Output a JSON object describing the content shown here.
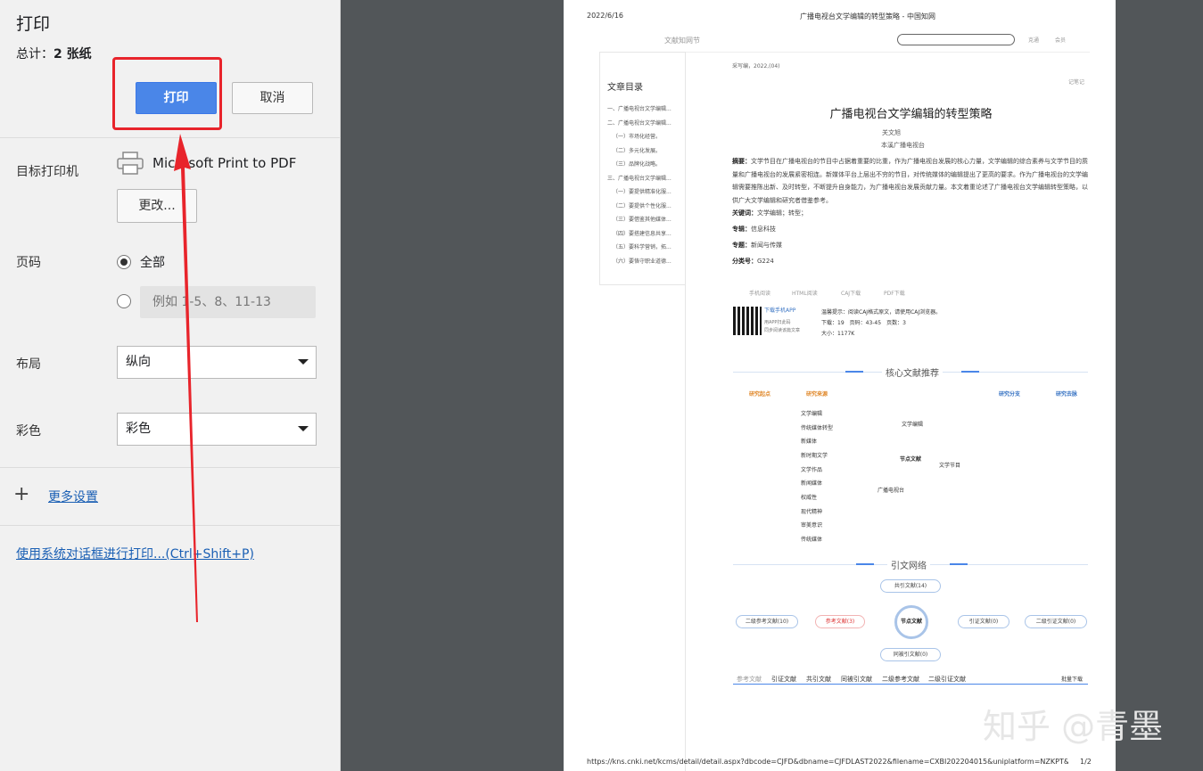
{
  "panel": {
    "title": "打印",
    "total_label": "总计：",
    "total_value": "2 张纸",
    "print_button": "打印",
    "cancel_button": "取消",
    "destination_label": "目标打印机",
    "printer_name": "Microsoft Print to PDF",
    "change_button": "更改...",
    "pages_label": "页码",
    "pages_all": "全部",
    "pages_custom_placeholder": "例如 1-5、8、11-13",
    "layout_label": "布局",
    "layout_value": "纵向",
    "color_label": "彩色",
    "color_value": "彩色",
    "more_settings": "更多设置",
    "system_dialog": "使用系统对话框进行打印...(Ctrl+Shift+P)"
  },
  "preview": {
    "date": "2022/6/16",
    "doc_title": "广播电视台文学编辑的转型策略 - 中国知网",
    "site_section": "文献知网节",
    "nav_links": [
      "克通",
      "会员"
    ],
    "journal_info": "采写编，2022,(04)",
    "note_link": "记笔记",
    "toc_title": "文章目录",
    "toc_items": [
      "一、广播电视台文学编辑...",
      "二、广播电视台文学编辑...",
      "（一）市场化经营。",
      "（二）多元化发展。",
      "（三）品牌化战略。",
      "三、广播电视台文学编辑...",
      "（一）要提供精准化服...",
      "（二）要提供个性化服...",
      "（三）要借鉴其他媒体...",
      "（四）要搭建信息共享...",
      "（五）要科学营销，拓...",
      "（六）要恪守职业道德..."
    ],
    "article_title": "广播电视台文学编辑的转型策略",
    "author": "关文旭",
    "affiliation": "本溪广播电视台",
    "abstract_label": "摘要：",
    "abstract_text": "文学节目在广播电视台的节目中占据着重要的比重，作为广播电视台发展的核心力量，文学编辑的综合素养与文学节目的质量和广播电视台的发展紧密相连。新媒体平台上层出不穷的节目，对传统媒体的编辑提出了更高的要求。作为广播电视台的文学编辑需要推陈出新、及时转型，不断提升自身能力，为广播电视台发展贡献力量。本文着重论述了广播电视台文学编辑转型策略，以供广大文学编辑和研究者借鉴参考。",
    "keywords_label": "关键词：",
    "keywords_value": "文学编辑；转型；",
    "subject_label": "专辑：",
    "subject_value": "信息科技",
    "topic_label": "专题：",
    "topic_value": "新闻与传媒",
    "class_label": "分类号：",
    "class_value": "G224",
    "download_tabs": [
      "手机阅读",
      "HTML阅读",
      "CAJ下载",
      "PDF下载"
    ],
    "app_download": "下载手机APP",
    "app_scan": "用APP扫此码",
    "app_sync": "同步阅读该篇文章",
    "reading_tip": "温馨提示：阅读CAJ格式原文，请使用CAJ浏览器。",
    "download_stats": "下载：19　页码：43-45　页数：3",
    "file_size": "大小：1177K",
    "core_recommend": "核心文献推荐",
    "network_labels": [
      "研究起点",
      "研究来源",
      "研究分支",
      "研究去脉"
    ],
    "network_words": [
      "文学编辑",
      "传统媒体转型",
      "新媒体",
      "新时期文学",
      "文学作品",
      "新闻媒体",
      "权威性",
      "现代精神",
      "审美意识",
      "传统媒体"
    ],
    "network_center": [
      "文学编辑",
      "节点文献",
      "文学节目",
      "广播电视台"
    ],
    "citation_network": "引文网络",
    "citation_nodes": [
      "共引文献(14)",
      "二级参考文献(10)",
      "参考文献(3)",
      "节点文献",
      "引证文献(0)",
      "二级引证文献(0)",
      "同被引文献(0)"
    ],
    "bottom_tabs": [
      "参考文献",
      "引证文献",
      "共引文献",
      "同被引文献",
      "二级参考文献",
      "二级引证文献"
    ],
    "batch_download": "批量下载",
    "url": "https://kns.cnki.net/kcms/detail/detail.aspx?dbcode=CJFD&dbname=CJFDLAST2022&filename=CXBI202204015&uniplatform=NZKPT&v=CmIU...",
    "page_count": "1/2"
  },
  "watermark": "知乎 @青墨",
  "colors": {
    "accent": "#4a86e8",
    "annotation": "#e8242b",
    "viewer_bg": "#525659"
  }
}
